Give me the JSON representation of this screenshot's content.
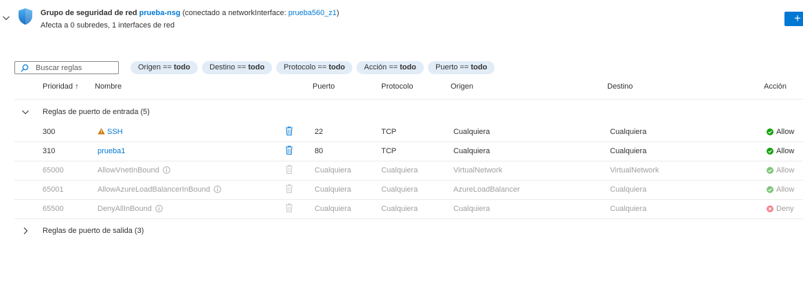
{
  "header": {
    "title_prefix": "Grupo de seguridad de red",
    "nsg_name": "prueba-nsg",
    "connected_prefix": "(conectado a networkInterface:",
    "nic_name": "prueba560_z1",
    "connected_suffix": ")",
    "subtitle": "Afecta a 0 subredes, 1 interfaces de red",
    "add_icon": "plus-icon"
  },
  "filters": {
    "search_placeholder": "Buscar reglas",
    "pills": [
      {
        "label": "Origen == ",
        "value": "todo"
      },
      {
        "label": "Destino == ",
        "value": "todo"
      },
      {
        "label": "Protocolo == ",
        "value": "todo"
      },
      {
        "label": "Acción == ",
        "value": "todo"
      },
      {
        "label": "Puerto == ",
        "value": "todo"
      }
    ]
  },
  "table": {
    "columns": {
      "priority": "Prioridad ↑",
      "name": "Nombre",
      "port": "Puerto",
      "protocol": "Protocolo",
      "source": "Origen",
      "destination": "Destino",
      "action": "Acción"
    },
    "inbound_group": "Reglas de puerto de entrada (5)",
    "outbound_group": "Reglas de puerto de salida (3)",
    "inbound_rules": [
      {
        "priority": "300",
        "name": "SSH",
        "port": "22",
        "protocol": "TCP",
        "source": "Cualquiera",
        "destination": "Cualquiera",
        "action": "Allow"
      },
      {
        "priority": "310",
        "name": "prueba1",
        "port": "80",
        "protocol": "TCP",
        "source": "Cualquiera",
        "destination": "Cualquiera",
        "action": "Allow"
      },
      {
        "priority": "65000",
        "name": "AllowVnetInBound",
        "port": "Cualquiera",
        "protocol": "Cualquiera",
        "source": "VirtualNetwork",
        "destination": "VirtualNetwork",
        "action": "Allow"
      },
      {
        "priority": "65001",
        "name": "AllowAzureLoadBalancerInBound",
        "port": "Cualquiera",
        "protocol": "Cualquiera",
        "source": "AzureLoadBalancer",
        "destination": "Cualquiera",
        "action": "Allow"
      },
      {
        "priority": "65500",
        "name": "DenyAllInBound",
        "port": "Cualquiera",
        "protocol": "Cualquiera",
        "source": "Cualquiera",
        "destination": "Cualquiera",
        "action": "Deny"
      }
    ]
  },
  "colors": {
    "accent": "#0078d4",
    "allow": "#13a10e",
    "deny": "#e74856",
    "warning": "#d47500",
    "pill_bg": "#e1ecf7"
  }
}
